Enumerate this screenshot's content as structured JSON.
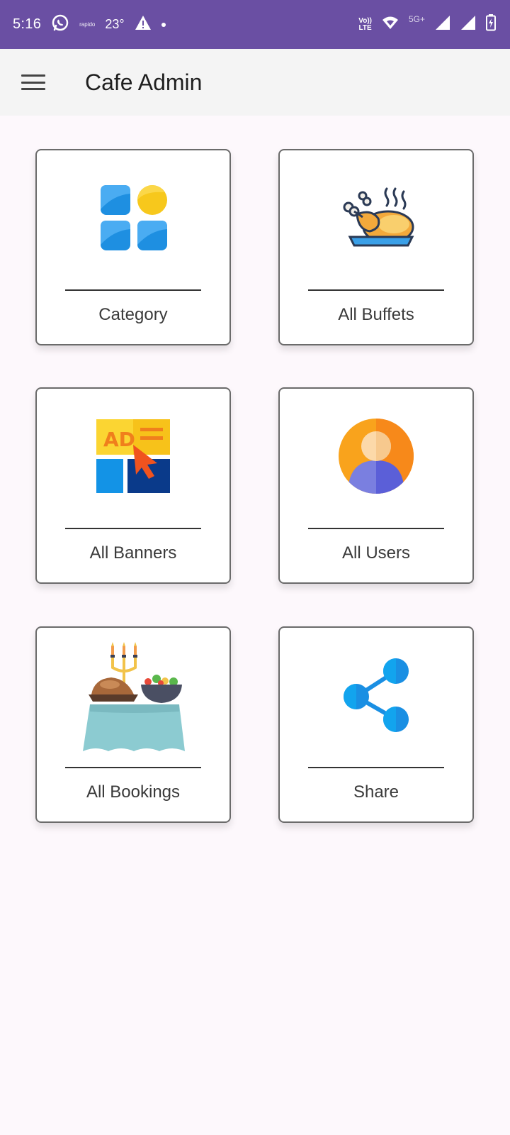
{
  "status_bar": {
    "time": "5:16",
    "small_text": "rapido",
    "temperature": "23°",
    "network_top": "Vo))",
    "network_bottom": "LTE",
    "signal_label": "5G+"
  },
  "app_bar": {
    "title": "Cafe Admin",
    "menu_icon": "hamburger-menu-icon"
  },
  "cards": [
    {
      "label": "Category",
      "icon": "category-grid-icon"
    },
    {
      "label": "All Buffets",
      "icon": "roast-chicken-icon"
    },
    {
      "label": "All Banners",
      "icon": "ad-banner-icon"
    },
    {
      "label": "All Users",
      "icon": "user-avatar-icon"
    },
    {
      "label": "All Bookings",
      "icon": "buffet-table-icon"
    },
    {
      "label": "Share",
      "icon": "share-icon"
    }
  ],
  "colors": {
    "status_bar": "#6a4fa3",
    "app_bar": "#f4f4f4",
    "background": "#fdf8fc",
    "card_border": "#6b6b6b"
  }
}
